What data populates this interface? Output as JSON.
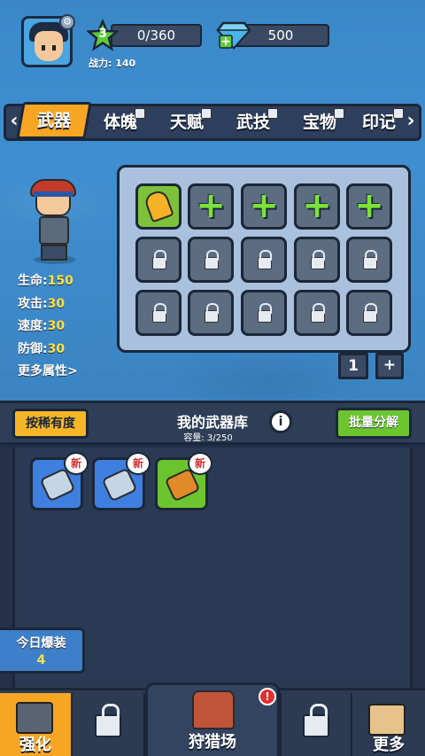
{
  "player": {
    "level": "3",
    "exp": "0/360",
    "gems": "500",
    "power_label": "战力:",
    "power_value": "140"
  },
  "tabs": [
    {
      "label": "武器",
      "locked": false,
      "active": true
    },
    {
      "label": "体魄",
      "locked": true
    },
    {
      "label": "天赋",
      "locked": true
    },
    {
      "label": "武技",
      "locked": true
    },
    {
      "label": "宝物",
      "locked": true
    },
    {
      "label": "印记",
      "locked": true
    }
  ],
  "stats": {
    "hp_label": "生命:",
    "hp": "150",
    "atk_label": "攻击:",
    "atk": "30",
    "spd_label": "速度:",
    "spd": "30",
    "def_label": "防御:",
    "def": "30",
    "more": "更多属性>"
  },
  "slots": {
    "count": "1",
    "add": "+"
  },
  "inventory": {
    "sort_button": "按稀有度",
    "title": "我的武器库",
    "capacity": "容量: 3/250",
    "info": "i",
    "decompose_button": "批量分解",
    "new_badge": "新"
  },
  "daily": {
    "label": "今日爆装",
    "count": "4"
  },
  "nav": {
    "forge": "强化",
    "hunt": "狩猎场",
    "more": "更多",
    "alert": "!"
  },
  "colors": {
    "accent": "#f6a623",
    "green": "#6cc52f",
    "blue_bg": "#3b84c3",
    "dark": "#1b2638"
  }
}
